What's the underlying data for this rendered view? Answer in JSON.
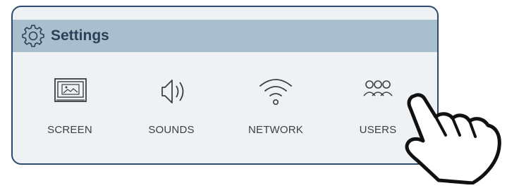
{
  "settings": {
    "title": "Settings",
    "icon": "gear-icon",
    "items": [
      {
        "label": "SCREEN",
        "icon": "monitor-icon"
      },
      {
        "label": "SOUNDS",
        "icon": "speaker-icon"
      },
      {
        "label": "NETWORK",
        "icon": "wifi-icon"
      },
      {
        "label": "USERS",
        "icon": "users-icon"
      }
    ]
  },
  "colors": {
    "border": "#2e4a6e",
    "header": "#a9bfce",
    "panel": "#eef2f5",
    "icon_stroke": "#3a3f45"
  },
  "pointer": {
    "icon": "pointing-hand-icon"
  }
}
